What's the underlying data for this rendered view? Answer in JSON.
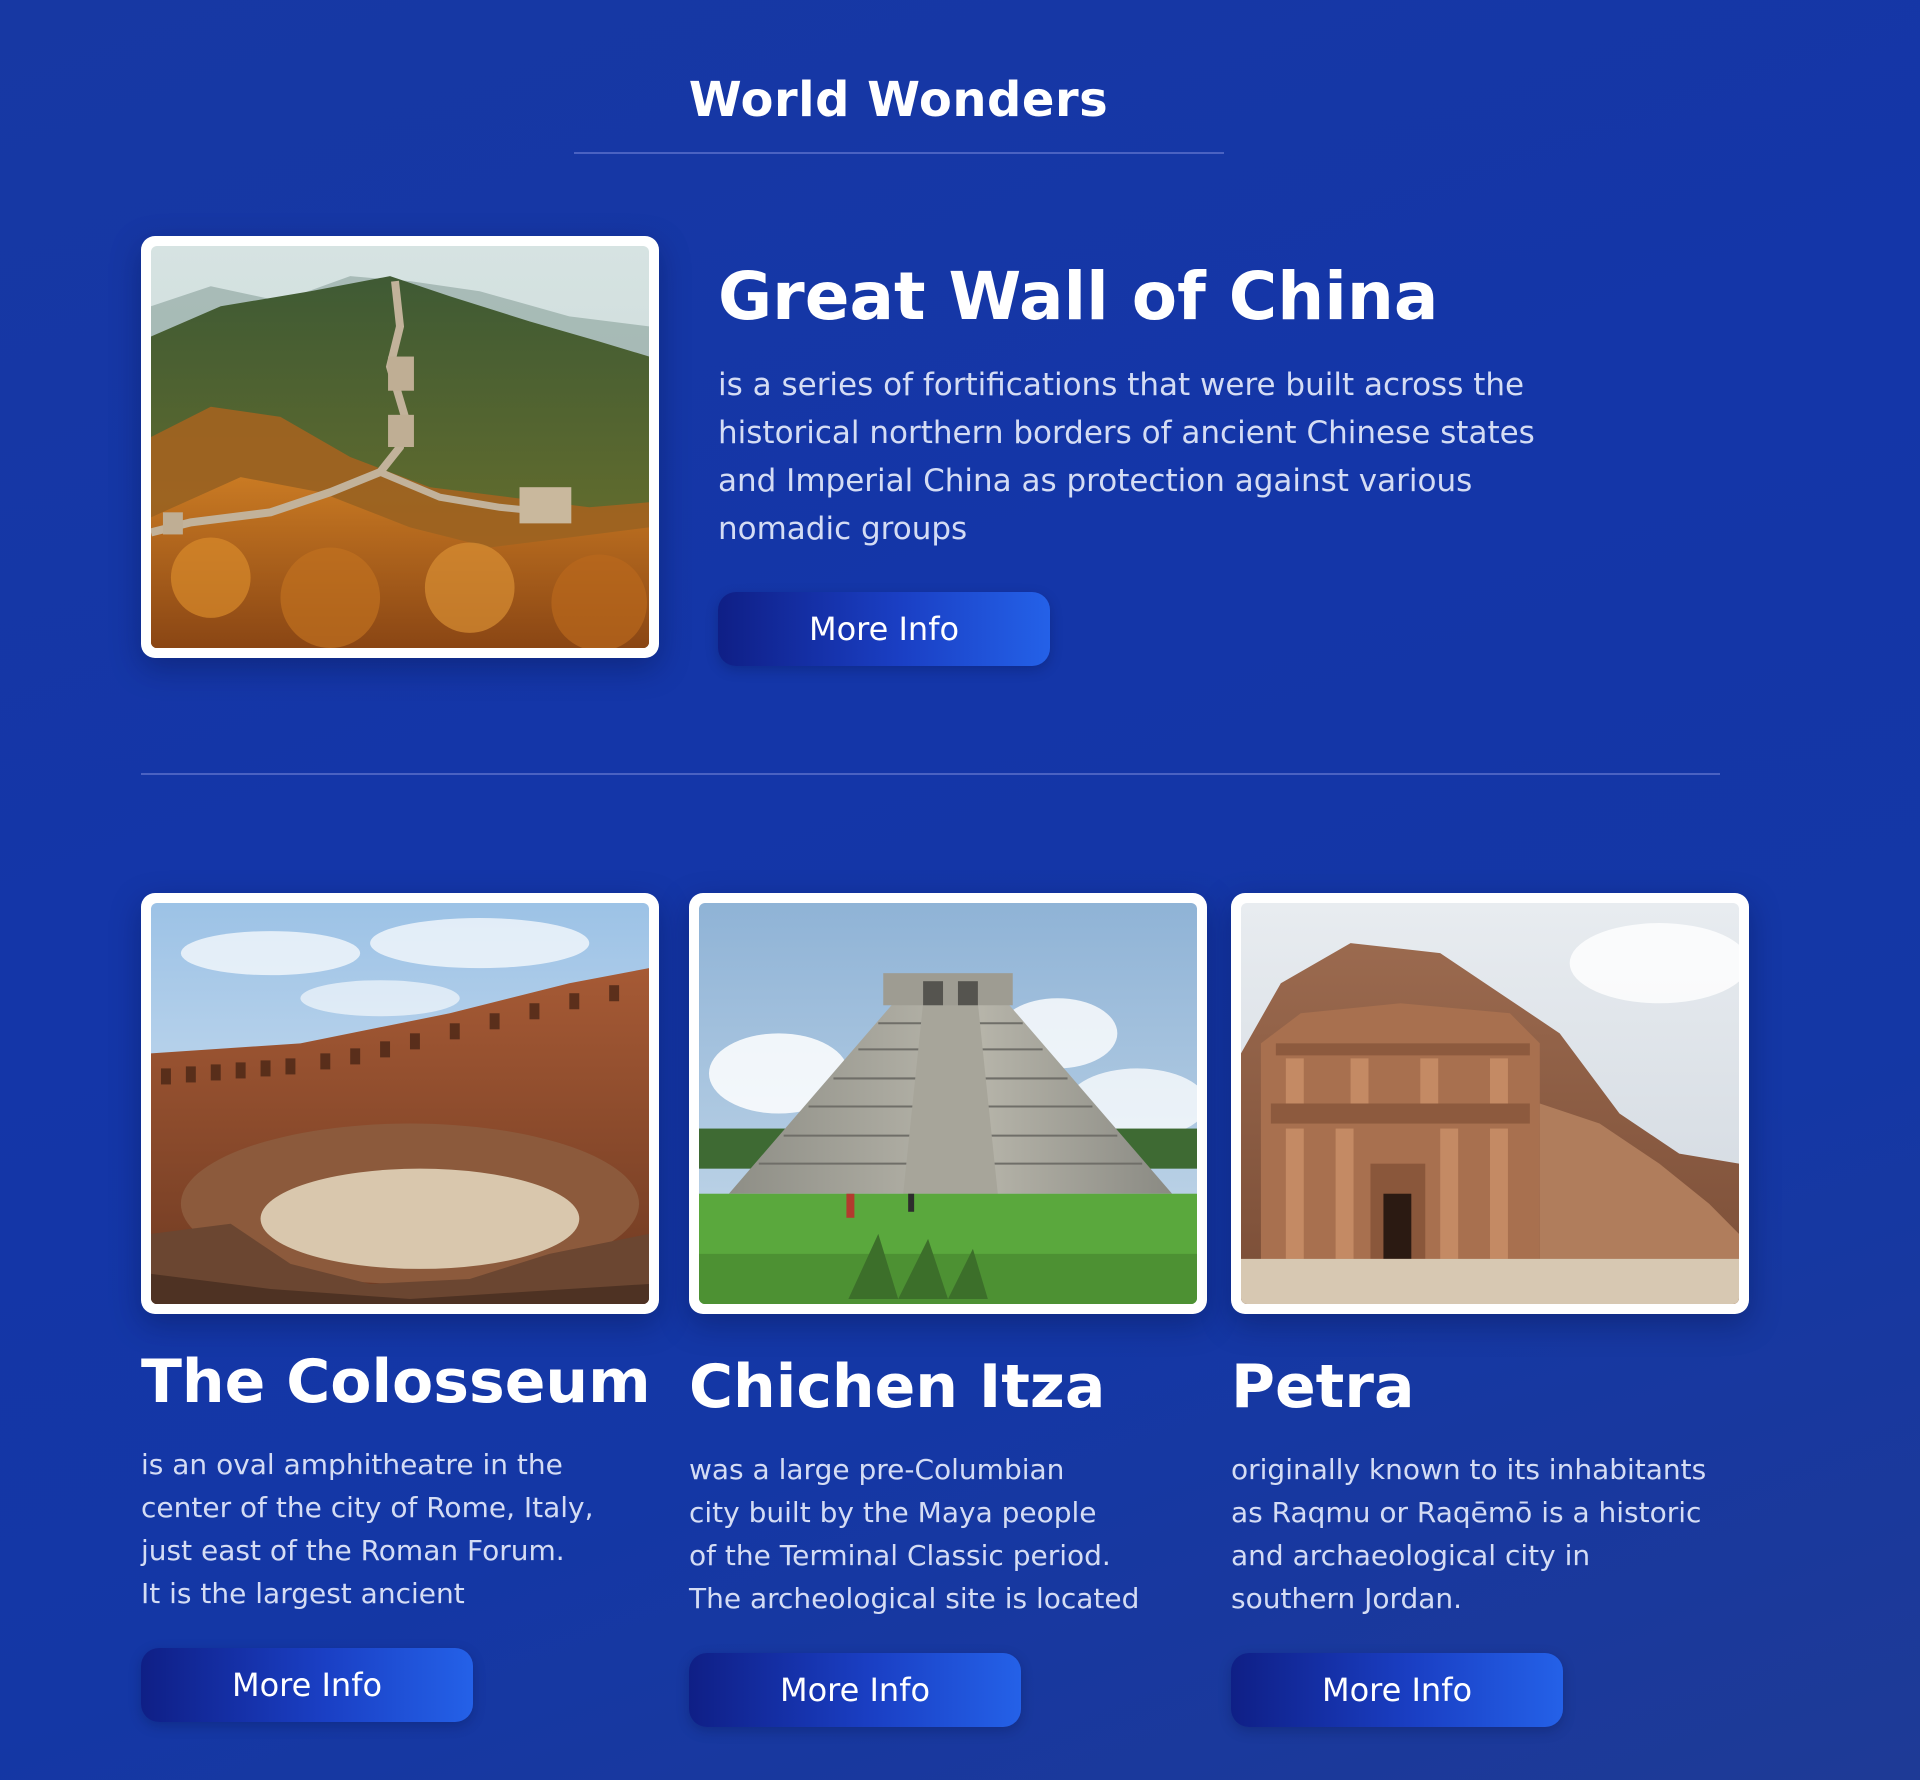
{
  "page": {
    "title": "World Wonders"
  },
  "featured": {
    "title": "Great Wall of China",
    "description": "is a series of fortifications that were built across the historical northern borders of ancient Chinese states and Imperial China as protection against various nomadic groups",
    "button_label": "More Info",
    "image_icon": "great-wall-photo"
  },
  "cards": [
    {
      "title": "The Colosseum",
      "description_lines": [
        "is an oval amphitheatre in the",
        "center of the city of Rome, Italy,",
        "just east of the Roman Forum.",
        "It is the largest ancient"
      ],
      "button_label": "More Info",
      "image_icon": "colosseum-photo"
    },
    {
      "title": "Chichen Itza",
      "description_lines": [
        "was a large pre-Columbian",
        "city built by the Maya people",
        "of the Terminal Classic period.",
        "The archeological site is located"
      ],
      "button_label": "More Info",
      "image_icon": "chichen-itza-photo"
    },
    {
      "title": "Petra",
      "description_lines": [
        "originally known to its inhabitants",
        "as Raqmu or Raqēmō is a historic",
        "and archaeological city in",
        "southern Jordan."
      ],
      "button_label": "More Info",
      "image_icon": "petra-photo"
    }
  ],
  "colors": {
    "background": "#1436a8",
    "button_start": "#0f1f86",
    "button_end": "#2461e8",
    "text_primary": "#ffffff",
    "text_secondary": "#d4dcf4"
  }
}
